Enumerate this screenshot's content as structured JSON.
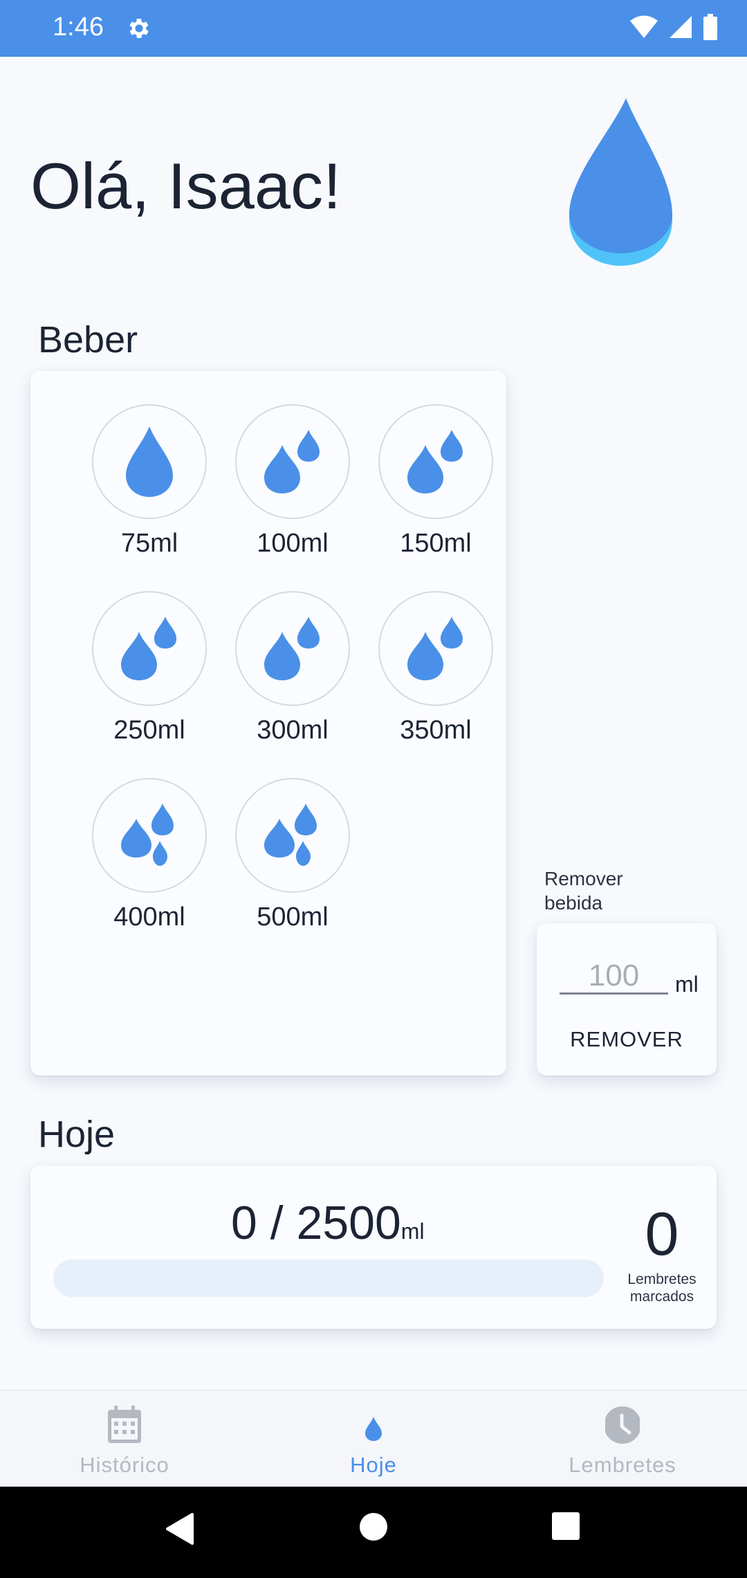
{
  "status_bar": {
    "time": "1:46"
  },
  "header": {
    "greeting": "Olá, Isaac!"
  },
  "drink_section": {
    "title": "Beber",
    "options": [
      {
        "label": "75ml",
        "icon": "single-drop-icon"
      },
      {
        "label": "100ml",
        "icon": "double-drop-icon"
      },
      {
        "label": "150ml",
        "icon": "double-drop-icon"
      },
      {
        "label": "250ml",
        "icon": "double-drop-icon"
      },
      {
        "label": "300ml",
        "icon": "double-drop-icon"
      },
      {
        "label": "350ml",
        "icon": "double-drop-icon"
      },
      {
        "label": "400ml",
        "icon": "triple-drop-icon"
      },
      {
        "label": "500ml",
        "icon": "triple-drop-icon"
      }
    ]
  },
  "remove_drink": {
    "caption": "Remover\nbebida",
    "placeholder": "100",
    "unit": "ml",
    "button_label": "REMOVER"
  },
  "today": {
    "title": "Hoje",
    "consumed": "0 / 2500",
    "unit": "ml",
    "progress_fraction": 0,
    "reminders_count": "0",
    "reminders_label": "Lembretes marcados"
  },
  "bottom_nav": {
    "items": [
      {
        "label": "Histórico",
        "icon": "calendar-icon",
        "active": false
      },
      {
        "label": "Hoje",
        "icon": "water-drop-icon",
        "active": true
      },
      {
        "label": "Lembretes",
        "icon": "clock-icon",
        "active": false
      }
    ]
  },
  "colors": {
    "accent": "#4a90e8",
    "drop": "#4a90e8",
    "drop_base": "#4fc3f7",
    "status_bar": "#4a90e8"
  }
}
